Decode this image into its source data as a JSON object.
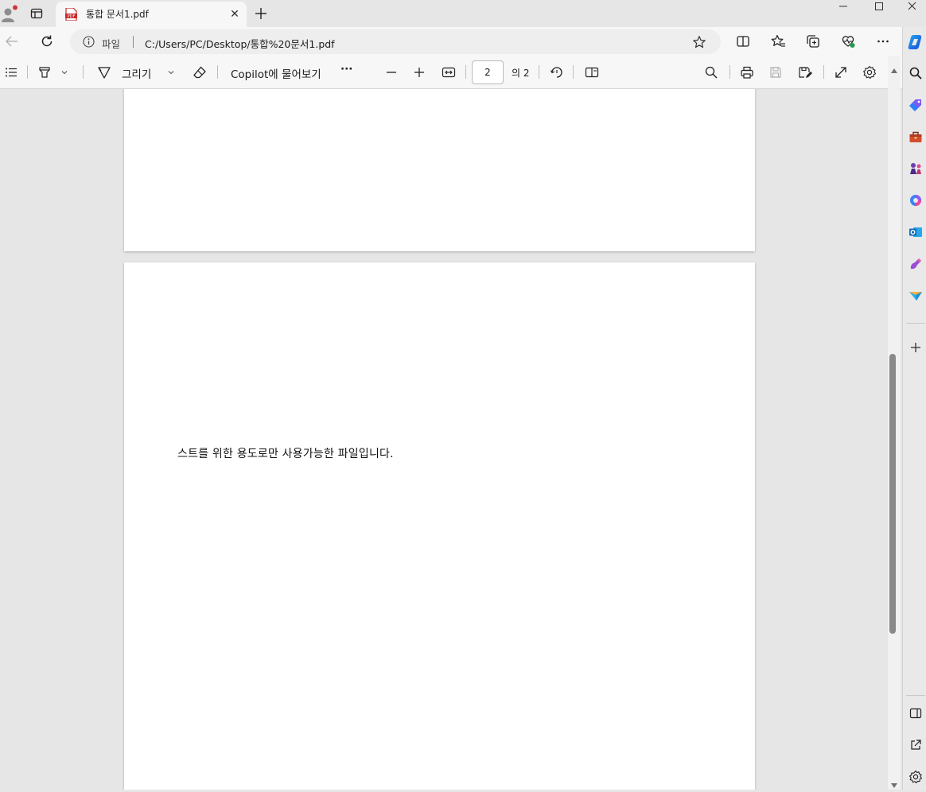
{
  "tab": {
    "title": "통합 문서1.pdf",
    "close": "✕"
  },
  "address": {
    "scheme_label": "파일",
    "url": "C:/Users/PC/Desktop/통합%20문서1.pdf"
  },
  "pdf_toolbar": {
    "draw_label": "그리기",
    "copilot_label": "Copilot에 물어보기",
    "more_label": "···",
    "current_page": "2",
    "page_total": "의 2"
  },
  "document": {
    "page2_text": "스트를 위한 용도로만 사용가능한 파일입니다."
  },
  "icons": {
    "browser": [
      "profile-icon",
      "tab-actions-icon",
      "pdf-file-icon",
      "close-icon",
      "new-tab-icon",
      "minimize-icon",
      "maximize-icon",
      "window-close-icon",
      "back-icon",
      "refresh-icon",
      "info-icon",
      "favorite-star-icon",
      "split-screen-icon",
      "favorites-icon",
      "collections-icon",
      "browser-essentials-icon",
      "more-icon",
      "copilot-icon"
    ],
    "pdf_toolbar": [
      "contents-icon",
      "highlight-icon",
      "chevron-down-icon",
      "draw-icon",
      "eraser-icon",
      "zoom-out-icon",
      "zoom-in-icon",
      "fit-width-icon",
      "rotate-icon",
      "page-view-icon",
      "search-icon",
      "print-icon",
      "save-icon",
      "save-as-icon",
      "fullscreen-icon",
      "settings-icon"
    ],
    "sidebar": [
      "search-icon",
      "tag-icon",
      "toolbox-icon",
      "games-icon",
      "microsoft365-icon",
      "outlook-icon",
      "designer-icon",
      "send-icon",
      "add-icon",
      "hide-sidebar-icon",
      "external-icon",
      "settings-icon"
    ]
  },
  "colors": {
    "accent_red": "#d13438",
    "outlook_blue": "#0f6cbd",
    "copilot_blue": "#1a73e8"
  }
}
